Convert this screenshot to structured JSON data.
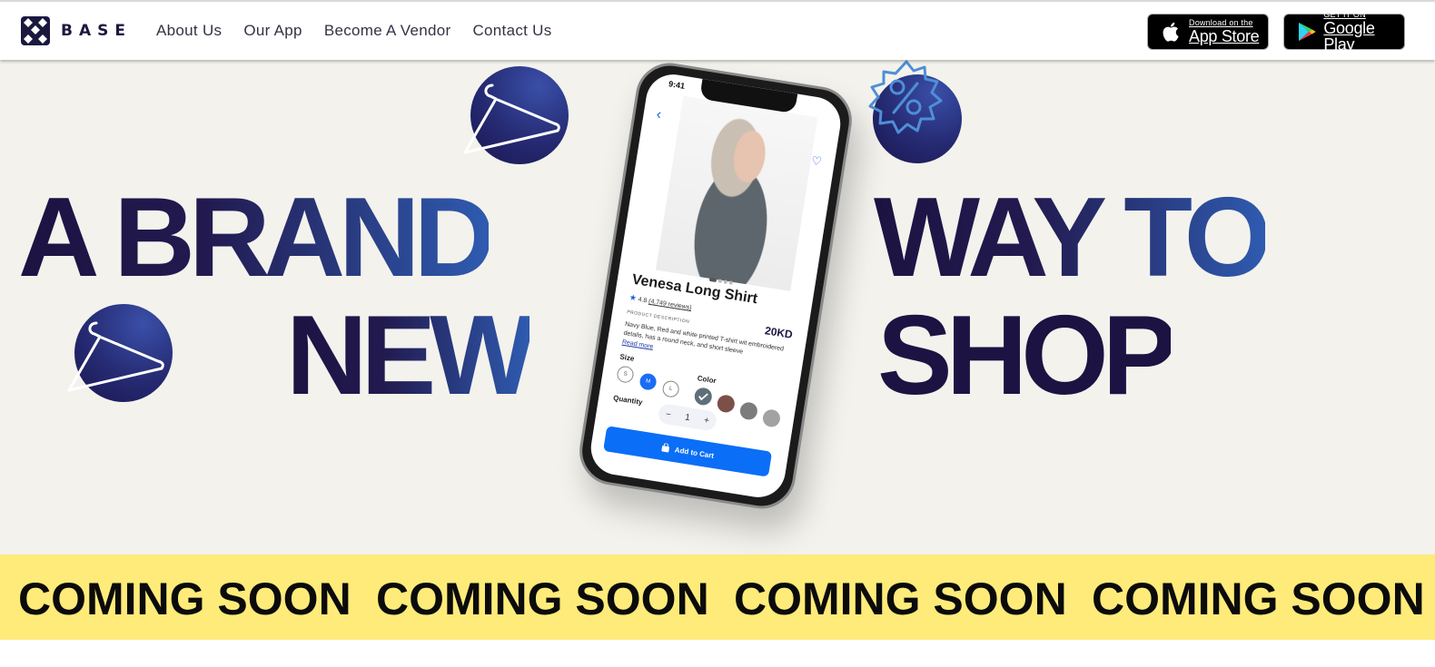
{
  "brand": {
    "name": "BASE",
    "logo_icon": "diamond-grid-logo-icon"
  },
  "nav": {
    "items": [
      "About Us",
      "Our App",
      "Become A Vendor",
      "Contact Us"
    ]
  },
  "stores": {
    "apple": {
      "small": "Download on the",
      "big": "App Store",
      "icon": "apple-icon"
    },
    "google": {
      "small": "GET IT ON",
      "big": "Google Play",
      "icon": "play-store-icon"
    }
  },
  "hero": {
    "words": [
      "A BRAND",
      "NEW",
      "WAY TO",
      "SHOP"
    ],
    "bubbles": [
      "hanger-icon",
      "hanger-icon",
      "discount-badge-icon"
    ],
    "colors": {
      "background": "#f3f2ed",
      "navy": "#1c1342",
      "blue": "#2f5bb0"
    }
  },
  "phone": {
    "status_time": "9:41",
    "product_name": "Venesa Long Shirt",
    "rating": "4.8",
    "reviews": "(4,749 reviews)",
    "price": "20KD",
    "desc_label": "PRODUCT DESCRIPTION",
    "description": "Navy Blue, Red and white printed T-shirt wit embroidered details, has a round neck, and short sleeve",
    "read_more": "Read more",
    "size_label": "Size",
    "sizes": [
      "S",
      "M",
      "L"
    ],
    "selected_size": "M",
    "color_label": "Color",
    "swatches": [
      "#5f6f7a",
      "#7a5048",
      "#7c7c7c",
      "#a2a2a2"
    ],
    "quantity_label": "Quantity",
    "quantity": "1",
    "minus": "−",
    "plus": "+",
    "add_to_cart": "Add to Cart",
    "accent": "#0b6ef7"
  },
  "ticker": {
    "items": [
      "COMING SOON",
      "COMING SOON",
      "COMING SOON",
      "COMING SOON"
    ],
    "background": "#feeb7a"
  }
}
